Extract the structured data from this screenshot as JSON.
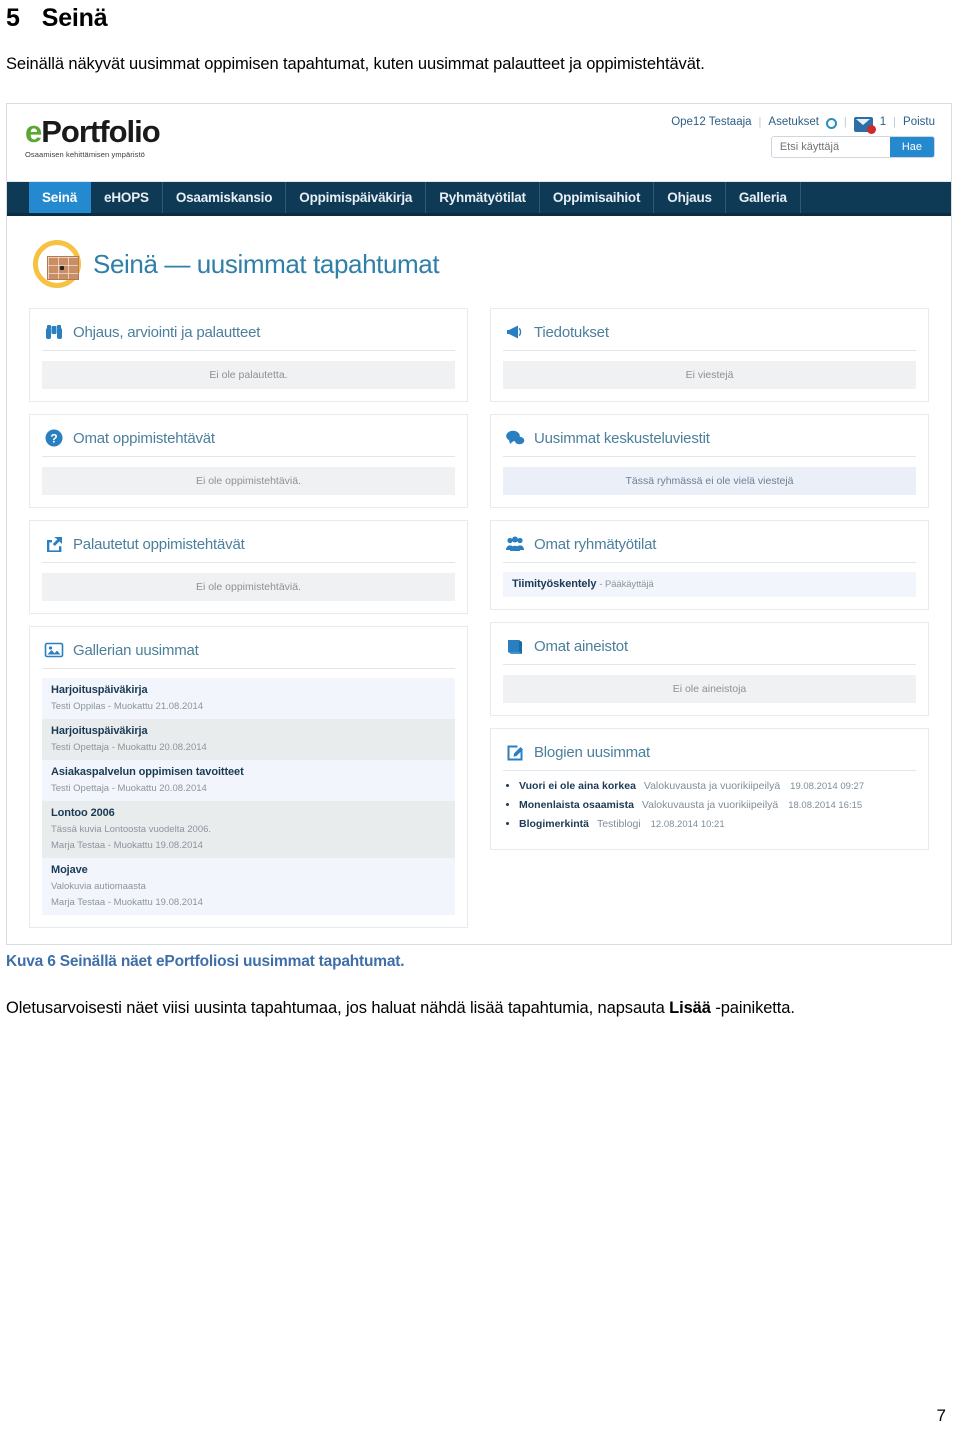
{
  "document": {
    "section_number": "5",
    "section_title": "Seinä",
    "intro": "Seinällä näkyvät uusimmat oppimisen tapahtumat, kuten uusimmat palautteet ja oppimistehtävät.",
    "caption": "Kuva 6 Seinällä näet ePortfoliosi uusimmat tapahtumat.",
    "body_before_bold": "Oletusarvoisesti näet viisi uusinta tapahtumaa, jos haluat nähdä lisää tapahtumia, napsauta ",
    "body_bold": "Lisää",
    "body_after_bold": " -painiketta.",
    "page_number": "7"
  },
  "screenshot": {
    "header": {
      "logo_first_letter": "e",
      "logo_rest": "Portfolio",
      "logo_tagline": "Osaamisen kehittämisen ympäristö",
      "user_name": "Ope12 Testaaja",
      "settings_label": "Asetukset",
      "message_count": "1",
      "logout_label": "Poistu",
      "search_placeholder": "Etsi käyttäjä",
      "search_button": "Hae",
      "accent_color": "#2489ce",
      "nav_bg_color": "#0f3a55"
    },
    "nav": {
      "items": [
        {
          "label": "Seinä",
          "active": true
        },
        {
          "label": "eHOPS",
          "active": false
        },
        {
          "label": "Osaamiskansio",
          "active": false
        },
        {
          "label": "Oppimispäiväkirja",
          "active": false
        },
        {
          "label": "Ryhmätyötilat",
          "active": false
        },
        {
          "label": "Oppimisaihiot",
          "active": false
        },
        {
          "label": "Ohjaus",
          "active": false
        },
        {
          "label": "Galleria",
          "active": false
        }
      ]
    },
    "page_title": "Seinä — uusimmat tapahtumat",
    "cards": {
      "feedback": {
        "title": "Ohjaus, arviointi ja palautteet",
        "icon": "binoculars-icon",
        "empty_text": "Ei ole palautetta."
      },
      "my_tasks": {
        "title": "Omat oppimistehtävät",
        "icon": "question-circle-icon",
        "empty_text": "Ei ole oppimistehtäviä."
      },
      "returned_tasks": {
        "title": "Palautetut oppimistehtävät",
        "icon": "share-out-icon",
        "empty_text": "Ei ole oppimistehtäviä."
      },
      "gallery": {
        "title": "Gallerian uusimmat",
        "icon": "image-icon",
        "items": [
          {
            "title": "Harjoituspäiväkirja",
            "meta": "Testi Oppilas - Muokattu 21.08.2014",
            "desc": ""
          },
          {
            "title": "Harjoituspäiväkirja",
            "meta": "Testi Opettaja - Muokattu 20.08.2014",
            "desc": ""
          },
          {
            "title": "Asiakaspalvelun oppimisen tavoitteet",
            "meta": "Testi Opettaja - Muokattu 20.08.2014",
            "desc": ""
          },
          {
            "title": "Lontoo 2006",
            "meta": "Marja Testaa - Muokattu 19.08.2014",
            "desc": "Tässä kuvia Lontoosta vuodelta 2006."
          },
          {
            "title": "Mojave",
            "meta": "Marja Testaa - Muokattu 19.08.2014",
            "desc": "Valokuvia autiomaasta"
          }
        ]
      },
      "announcements": {
        "title": "Tiedotukset",
        "icon": "megaphone-icon",
        "empty_text": "Ei viestejä"
      },
      "discussions": {
        "title": "Uusimmat keskusteluviestit",
        "icon": "speech-bubbles-icon",
        "empty_text": "Tässä ryhmässä ei ole vielä viestejä"
      },
      "groups": {
        "title": "Omat ryhmätyötilat",
        "icon": "people-icon",
        "items": [
          {
            "name": "Tiimityöskentely",
            "role": "- Pääkäyttäjä"
          }
        ]
      },
      "materials": {
        "title": "Omat aineistot",
        "icon": "book-icon",
        "empty_text": "Ei ole aineistoja"
      },
      "blogs": {
        "title": "Blogien uusimmat",
        "icon": "pencil-square-icon",
        "items": [
          {
            "title": "Vuori ei ole aina korkea",
            "source": "Valokuvausta ja vuorikiipeilyä",
            "date": "19.08.2014 09:27"
          },
          {
            "title": "Monenlaista osaamista",
            "source": "Valokuvausta ja vuorikiipeilyä",
            "date": "18.08.2014 16:15"
          },
          {
            "title": "Blogimerkintä",
            "source": "Testiblogi",
            "date": "12.08.2014 10:21"
          }
        ]
      }
    }
  }
}
